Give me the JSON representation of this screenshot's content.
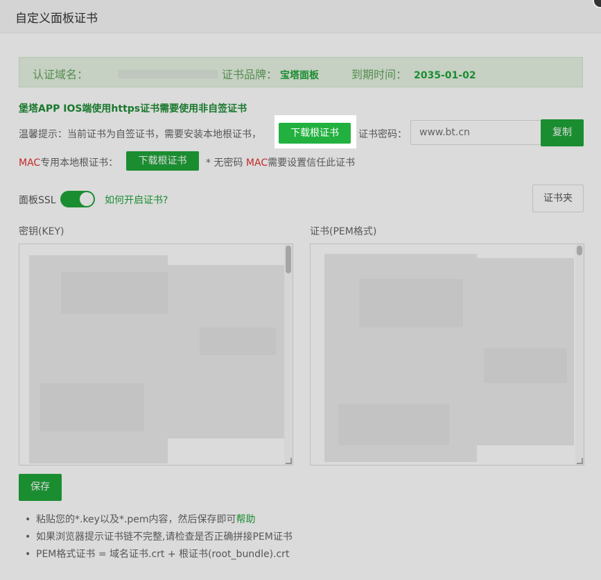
{
  "dialog": {
    "title": "自定义面板证书"
  },
  "info_bar": {
    "domain_label": "认证域名：",
    "brand_label": "证书品牌：",
    "brand_value": "宝塔面板",
    "expire_label": "到期时间：",
    "expire_value": "2035-01-02"
  },
  "warning": {
    "title": "堡塔APP IOS端使用https证书需要使用非自签证书"
  },
  "tip": {
    "text": "温馨提示：当前证书为自签证书，需要安装本地根证书，",
    "download_root_label": "下载根证书",
    "password_label": "证书密码：",
    "password_placeholder": "www.bt.cn",
    "copy_label": "复制"
  },
  "mac": {
    "prefix_red": "MAC",
    "prefix_rest": "专用本地根证书：",
    "download_label": "下载根证书",
    "note_star": "* 无密码 ",
    "note_red": "MAC",
    "note_rest": "需要设置信任此证书"
  },
  "ssl": {
    "label": "面板SSL",
    "enabled": true,
    "howto_link": "如何开启证书?",
    "cert_folder_label": "证书夹"
  },
  "fields": {
    "key_label": "密钥(KEY)",
    "pem_label": "证书(PEM格式)"
  },
  "save_label": "保存",
  "help": {
    "items": [
      {
        "text": "粘贴您的*.key以及*.pem内容，然后保存即可",
        "link": "帮助"
      },
      {
        "text": "如果浏览器提示证书链不完整,请检查是否正确拼接PEM证书",
        "link": ""
      },
      {
        "text": "PEM格式证书 = 域名证书.crt + 根证书(root_bundle).crt",
        "link": ""
      }
    ]
  },
  "colors": {
    "primary": "#20a53a",
    "danger": "#e5302f",
    "info_bg": "#e7f3e4"
  }
}
